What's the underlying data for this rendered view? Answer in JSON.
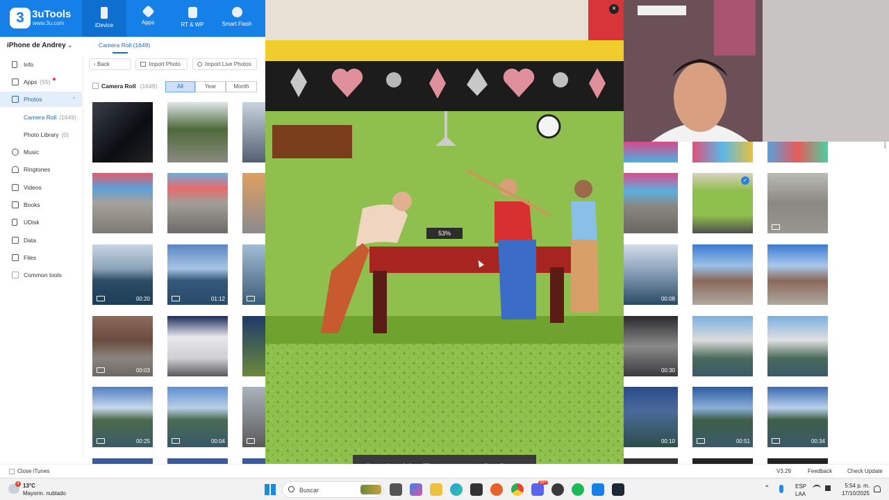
{
  "app": {
    "name": "3uTools",
    "site": "www.3u.com"
  },
  "nav": [
    {
      "label": "iDevice",
      "icon": "phone-icon"
    },
    {
      "label": "Apps",
      "icon": "cube-icon"
    },
    {
      "label": "RT & WP",
      "icon": "music-file-icon"
    },
    {
      "label": "Smart Flash",
      "icon": "flash-icon"
    }
  ],
  "device": {
    "name": "iPhone de Andrey"
  },
  "sidebar": {
    "items": [
      {
        "label": "Info",
        "count": ""
      },
      {
        "label": "Apps",
        "count": "(55)"
      },
      {
        "label": "Photos",
        "count": ""
      },
      {
        "label": "Camera Roll",
        "count": "(1649)"
      },
      {
        "label": "Photo Library",
        "count": "(0)"
      },
      {
        "label": "Music",
        "count": ""
      },
      {
        "label": "Ringtones",
        "count": ""
      },
      {
        "label": "Videos",
        "count": ""
      },
      {
        "label": "Books",
        "count": ""
      },
      {
        "label": "UDisk",
        "count": ""
      },
      {
        "label": "Data",
        "count": ""
      },
      {
        "label": "Files",
        "count": ""
      },
      {
        "label": "Common tools",
        "count": ""
      }
    ]
  },
  "main": {
    "tab": "Camera Roll (1649)",
    "toolbar": {
      "back": "Back",
      "import_photo": "Import Photo",
      "import_live": "Import Live Photos"
    },
    "album": {
      "label": "Camera Roll",
      "count": "(1649)"
    },
    "filters": [
      "All",
      "Year",
      "Month"
    ],
    "durations_left": [
      "",
      "",
      "",
      "",
      "",
      "",
      "00:20",
      "01:12",
      "00:03",
      "",
      "00:25",
      "00:04"
    ],
    "durations_right": [
      "",
      "",
      "",
      "00:08",
      "",
      "",
      "00:30",
      "",
      "",
      "00:10",
      "00:51",
      "00:34"
    ]
  },
  "viewer": {
    "zoom": "53%",
    "close": "×",
    "tools": [
      "zoom-in",
      "zoom-out",
      "1:1",
      "fit",
      "prev",
      "next",
      "rotate-left",
      "rotate-right",
      "save"
    ]
  },
  "statusbar": {
    "close_itunes": "Close iTunes",
    "version": "V3.29",
    "feedback": "Feedback",
    "check_update": "Check Update"
  },
  "taskbar": {
    "weather_temp": "13°C",
    "weather_desc": "Mayorm. nublado",
    "search": "Buscar",
    "lang": "ESP",
    "lang2": "LAA",
    "time": "5:54 p. m.",
    "date": "17/10/2025",
    "badge": "99+"
  }
}
